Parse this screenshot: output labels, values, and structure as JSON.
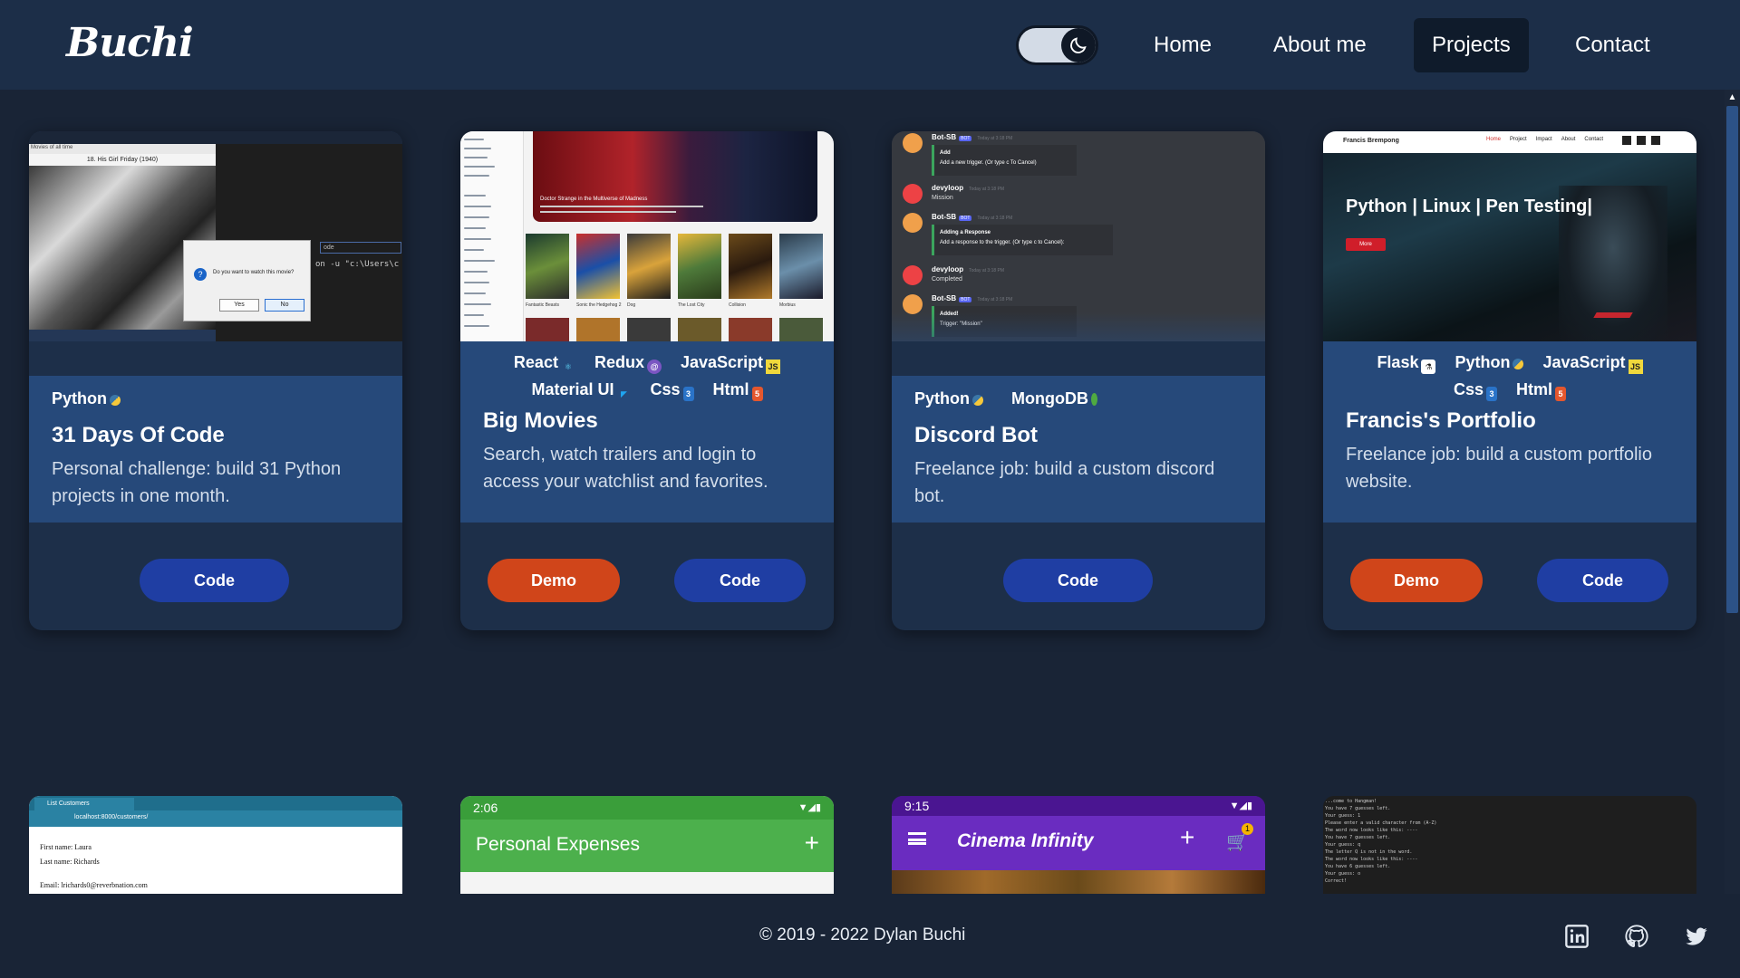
{
  "brand": "Buchi",
  "nav": {
    "home": "Home",
    "about": "About me",
    "projects": "Projects",
    "contact": "Contact"
  },
  "colors": {
    "navbar": "#1c2e48",
    "background": "#192436",
    "card_body": "#26497a",
    "code_button": "#1f3ea3",
    "demo_button": "#d0451a"
  },
  "cards": [
    {
      "tags": [
        "Python"
      ],
      "title": "31 Days Of Code",
      "desc": "Personal challenge: build 31 Python projects in one month.",
      "code": "Code",
      "image": {
        "window_title": "Movies of all time",
        "movie_label": "18. His Girl Friday (1940)",
        "dialog_text": "Do you want to watch this movie?",
        "yes": "Yes",
        "no": "No",
        "terminal": "on -u \"c:\\Users\\c"
      }
    },
    {
      "tags": [
        "React",
        "Redux",
        "JavaScript",
        "Material UI",
        "Css",
        "Html"
      ],
      "title": "Big Movies",
      "desc": "Search, watch trailers and login to access your watchlist and favorites.",
      "demo": "Demo",
      "code": "Code",
      "image": {
        "banner_caption": "Doctor Strange in the Multiverse of Madness",
        "posters": [
          "Fantastic Beasts",
          "Sonic the Hedgehog 2",
          "Dog",
          "The Lost City",
          "Collision",
          "Morbius"
        ]
      }
    },
    {
      "tags": [
        "Python",
        "MongoDB"
      ],
      "title": "Discord Bot",
      "desc": "Freelance job: build a custom discord bot.",
      "code": "Code",
      "image": {
        "messages": [
          {
            "user": "Bot-SB",
            "badge": "BOT",
            "time": "Today at 3:18 PM",
            "line1": "Add",
            "line2": "Add a new trigger. (Or type c To Cancel)"
          },
          {
            "user": "devyloop",
            "time": "Today at 3:18 PM",
            "line1": "Mission"
          },
          {
            "user": "Bot-SB",
            "badge": "BOT",
            "time": "Today at 3:18 PM",
            "line1": "Adding a Response",
            "line2": "Add a response to the trigger. (Or type c to Cancel):"
          },
          {
            "user": "devyloop",
            "time": "Today at 3:18 PM",
            "line1": "Completed"
          },
          {
            "user": "Bot-SB",
            "badge": "BOT",
            "time": "Today at 3:18 PM",
            "line1": "Added!",
            "line2": "Trigger: \"Mission\""
          }
        ]
      }
    },
    {
      "tags": [
        "Flask",
        "Python",
        "JavaScript",
        "Css",
        "Html"
      ],
      "title": "Francis's Portfolio",
      "desc": "Freelance job: build a custom portfolio website.",
      "demo": "Demo",
      "code": "Code",
      "image": {
        "site_name": "Francis Brempong",
        "menu": [
          "Home",
          "Project",
          "Impact",
          "About",
          "Contact"
        ],
        "headline": "Python | Linux | Pen Testing|",
        "cta": "More"
      }
    }
  ],
  "mini_cards": [
    {
      "tab": "List Customers",
      "url": "localhost:8000/customers/",
      "fields": [
        "First name: Laura",
        "Last name: Richards",
        "Email: lrichards0@reverbnation.com"
      ]
    },
    {
      "time": "2:06",
      "title": "Personal Expenses"
    },
    {
      "time": "9:15",
      "title": "Cinema Infinity",
      "cart_count": "1"
    },
    {
      "lines": [
        "...come to Hangman!",
        "You have 7 guesses left.",
        "Your guess: 1",
        "Please enter a valid character from (A-Z)",
        "The word now looks like this: ----",
        "You have 7 guesses left.",
        "Your guess: q",
        "The letter Q is not in the word.",
        "The word now looks like this: ----",
        "You have 6 guesses left.",
        "Your guess: o",
        "Correct!"
      ]
    }
  ],
  "footer": {
    "copyright": "© 2019 - 2022   Dylan Buchi"
  }
}
